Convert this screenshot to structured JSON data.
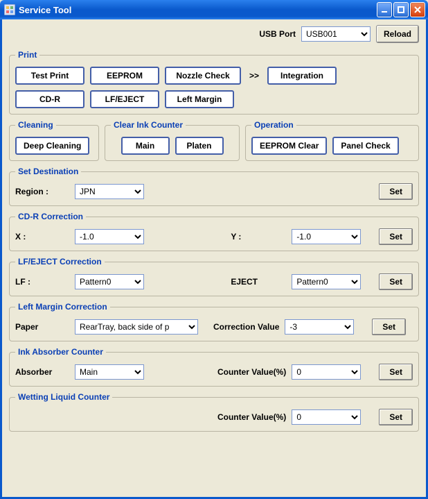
{
  "titlebar": {
    "title": "Service Tool"
  },
  "top": {
    "usb_label": "USB Port",
    "usb_value": "USB001",
    "reload": "Reload"
  },
  "print": {
    "legend": "Print",
    "test_print": "Test Print",
    "eeprom": "EEPROM",
    "nozzle_check": "Nozzle Check",
    "integration": "Integration",
    "cd_r": "CD-R",
    "lf_eject": "LF/EJECT",
    "left_margin": "Left Margin"
  },
  "cleaning": {
    "legend": "Cleaning",
    "deep": "Deep Cleaning"
  },
  "clear_ink": {
    "legend": "Clear Ink Counter",
    "main": "Main",
    "platen": "Platen"
  },
  "operation": {
    "legend": "Operation",
    "eeprom_clear": "EEPROM Clear",
    "panel_check": "Panel Check"
  },
  "dest": {
    "legend": "Set Destination",
    "region_label": "Region :",
    "region_value": "JPN",
    "set": "Set"
  },
  "cdr_corr": {
    "legend": "CD-R Correction",
    "x_label": "X :",
    "x_value": "-1.0",
    "y_label": "Y :",
    "y_value": "-1.0",
    "set": "Set"
  },
  "lf_corr": {
    "legend": "LF/EJECT Correction",
    "lf_label": "LF :",
    "lf_value": "Pattern0",
    "eject_label": "EJECT",
    "eject_value": "Pattern0",
    "set": "Set"
  },
  "lm_corr": {
    "legend": "Left Margin Correction",
    "paper_label": "Paper",
    "paper_value": "RearTray, back side of p",
    "corr_label": "Correction Value",
    "corr_value": "-3",
    "set": "Set"
  },
  "absorber": {
    "legend": "Ink Absorber Counter",
    "abs_label": "Absorber",
    "abs_value": "Main",
    "cv_label": "Counter Value(%)",
    "cv_value": "0",
    "set": "Set"
  },
  "wetting": {
    "legend": "Wetting Liquid Counter",
    "cv_label": "Counter Value(%)",
    "cv_value": "0",
    "set": "Set"
  }
}
